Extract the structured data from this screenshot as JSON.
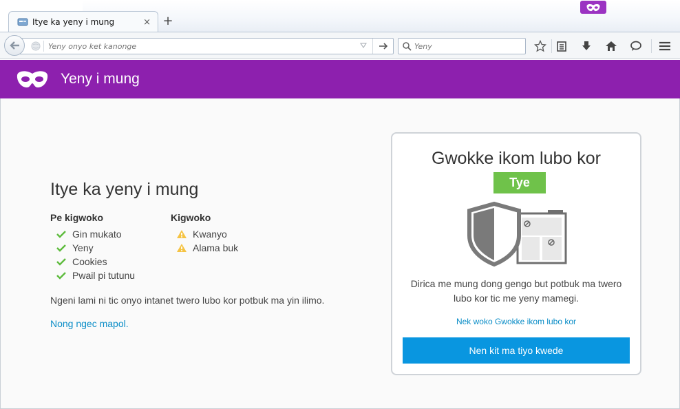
{
  "tab": {
    "title": "Itye ka yeny i mung",
    "close_glyph": "×",
    "new_tab_glyph": "+"
  },
  "navbar": {
    "url_placeholder": "Yeny onyo ket kanonge",
    "search_placeholder": "Yeny"
  },
  "header": {
    "title": "Yeny i mung",
    "color": "#8d20ae"
  },
  "main": {
    "heading": "Itye ka yeny i mung",
    "saved_heading": "Pe kigwoko",
    "saved_items": [
      "Gin mukato",
      "Yeny",
      "Cookies",
      "Pwail pi tutunu"
    ],
    "kept_heading": "Kigwoko",
    "kept_items": [
      "Kwanyo",
      "Alama buk"
    ],
    "info": "Ngeni lami ni tic onyo intanet twero lubo kor potbuk ma yin ilimo.",
    "learn_more": "Nong ngec mapol."
  },
  "tracking": {
    "title": "Gwokke ikom lubo kor",
    "toggle_label": "Tye",
    "description": "Dirica me mung dong gengo but potbuk ma twero lubo kor tic me yeny mamegi.",
    "learn_link": "Nek woko Gwokke ikom lubo kor",
    "button": "Nen kit ma tiyo kwede"
  },
  "colors": {
    "accent_purple": "#8d20ae",
    "toggle_green": "#6fc24a",
    "link_blue": "#0a8dc7",
    "button_blue": "#0996e0"
  },
  "icons": {
    "check": "check-icon",
    "warning": "warning-icon",
    "mask": "private-mask-icon"
  }
}
